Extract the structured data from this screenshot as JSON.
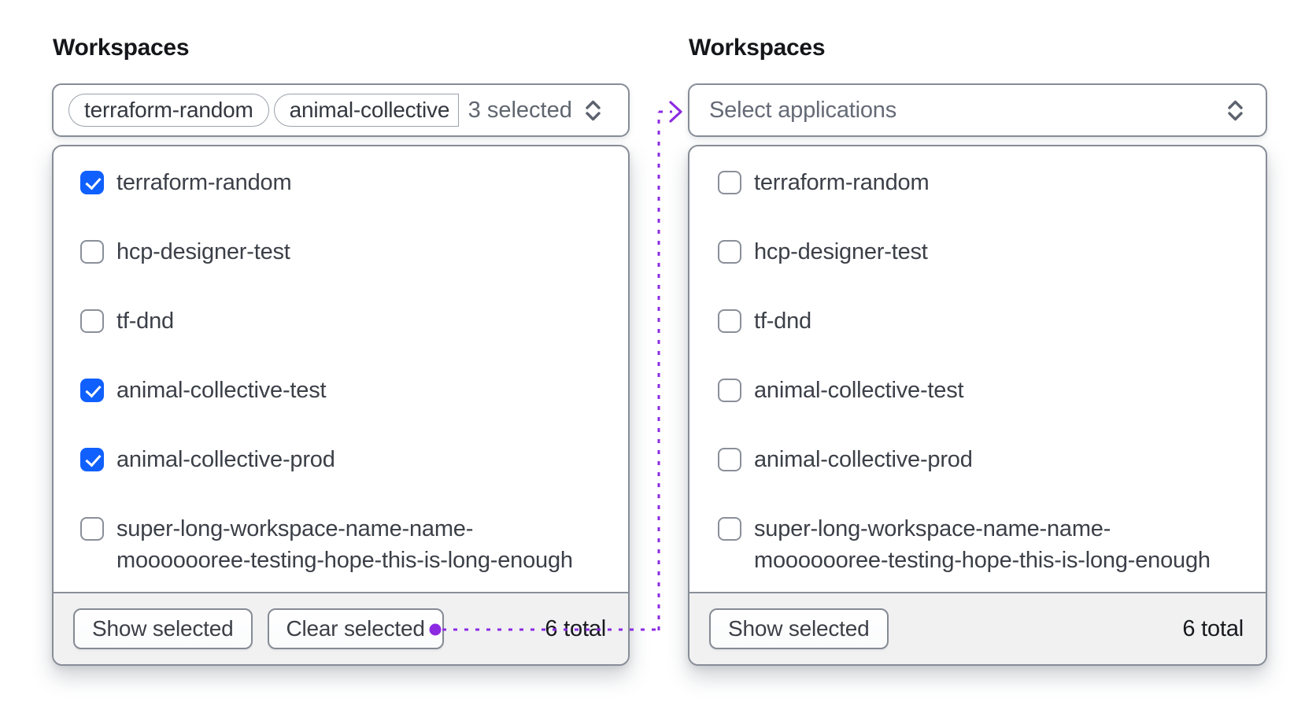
{
  "accent": {
    "purple": "#8c2ae2",
    "checkbox_blue": "#1060ff"
  },
  "left_panel": {
    "label": "Workspaces",
    "trigger": {
      "tags": [
        "terraform-random",
        "animal-collective"
      ],
      "count_text": "3 selected"
    },
    "options": [
      {
        "label": "terraform-random",
        "checked": true
      },
      {
        "label": "hcp-designer-test",
        "checked": false
      },
      {
        "label": "tf-dnd",
        "checked": false
      },
      {
        "label": "animal-collective-test",
        "checked": true
      },
      {
        "label": "animal-collective-prod",
        "checked": true
      },
      {
        "label": [
          "super-long-workspace-name-name-",
          "mooooooree-testing-hope-this-is-long-enough"
        ],
        "checked": false
      }
    ],
    "footer": {
      "show_selected_label": "Show selected",
      "clear_selected_label": "Clear selected",
      "total_text": "6 total"
    }
  },
  "right_panel": {
    "label": "Workspaces",
    "trigger": {
      "placeholder": "Select applications"
    },
    "options": [
      {
        "label": "terraform-random",
        "checked": false
      },
      {
        "label": "hcp-designer-test",
        "checked": false
      },
      {
        "label": "tf-dnd",
        "checked": false
      },
      {
        "label": "animal-collective-test",
        "checked": false
      },
      {
        "label": "animal-collective-prod",
        "checked": false
      },
      {
        "label": [
          "super-long-workspace-name-name-",
          "mooooooree-testing-hope-this-is-long-enough"
        ],
        "checked": false
      }
    ],
    "footer": {
      "show_selected_label": "Show selected",
      "total_text": "6 total"
    }
  }
}
